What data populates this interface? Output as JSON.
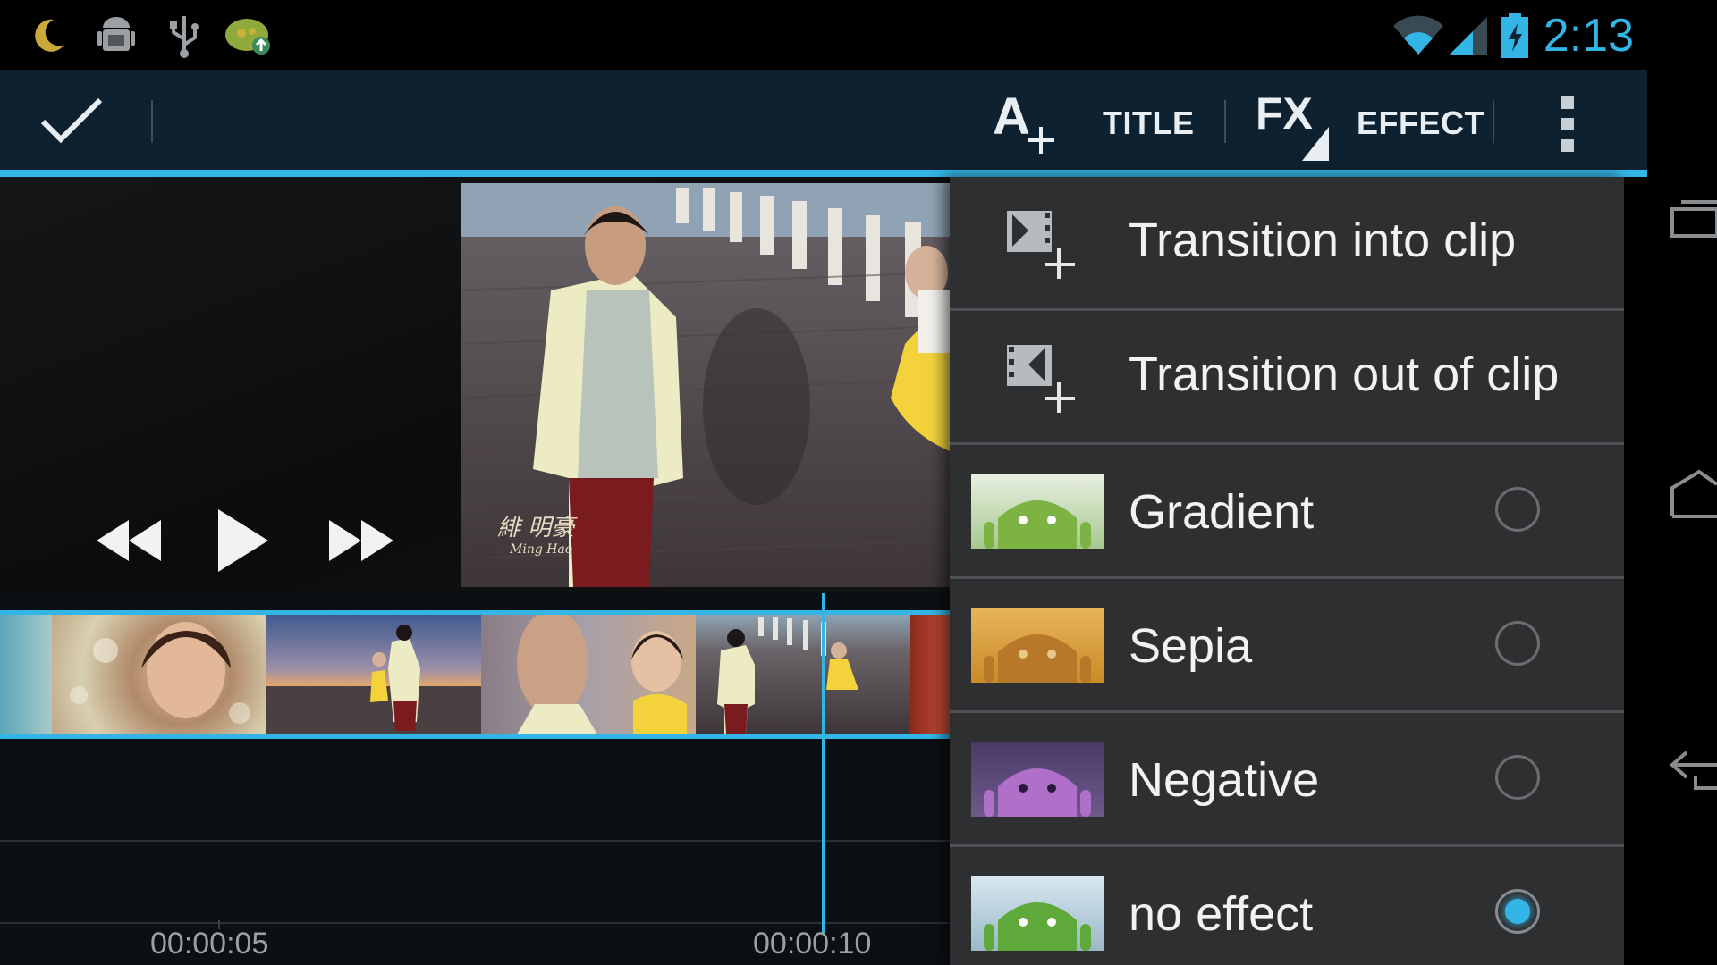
{
  "status_bar": {
    "time": "2:13",
    "icons": [
      "moon-icon",
      "android-debug-icon",
      "usb-icon",
      "app-update-icon",
      "wifi-icon",
      "signal-icon",
      "battery-charging-icon"
    ],
    "accent_color": "#33b5e5"
  },
  "action_bar": {
    "confirm_icon": "checkmark-icon",
    "title_label": "TITLE",
    "effect_label": "EFFECT",
    "title_icon": "add-title-icon",
    "effect_icon": "fx-icon",
    "overflow_icon": "overflow-menu-icon",
    "background_color": "#0e2130"
  },
  "player": {
    "controls": [
      "rewind-icon",
      "play-icon",
      "fast-forward-icon"
    ],
    "watermark_text": "緋 明豪",
    "watermark_sub": "Ming Hao"
  },
  "timeline": {
    "timecodes": [
      "00:00:05",
      "00:00:10"
    ]
  },
  "menu": {
    "items": [
      {
        "label": "Transition into clip",
        "icon": "transition-in-icon"
      },
      {
        "label": "Transition out of clip",
        "icon": "transition-out-icon"
      },
      {
        "label": "Gradient",
        "thumb_color": "#7cb342",
        "selected": false
      },
      {
        "label": "Sepia",
        "thumb_color": "#d79a2e",
        "selected": false
      },
      {
        "label": "Negative",
        "thumb_color": "#9b6fb0",
        "selected": false
      },
      {
        "label": "no effect",
        "thumb_color": "#7cb342",
        "selected": true
      }
    ]
  },
  "nav_bar": {
    "icons": [
      "recent-apps-icon",
      "home-icon",
      "back-icon"
    ]
  }
}
